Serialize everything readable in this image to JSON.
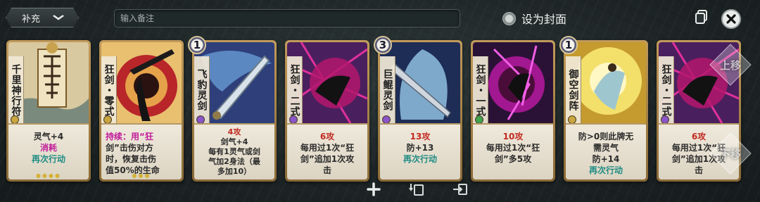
{
  "toolbar": {
    "dropdown_label": "补充",
    "note_placeholder": "输入备注",
    "set_cover_label": "设为封面"
  },
  "cards": [
    {
      "name": "千里神行符",
      "level": "",
      "lines": [
        "灵气+4",
        "消耗",
        "再次行动"
      ]
    },
    {
      "name": "狂剑・零式",
      "level": "",
      "lines": [
        "持续：用“狂",
        "剑”击伤对方",
        "时，恢复击伤",
        "值50%的生命"
      ]
    },
    {
      "name": "飞豹灵剑",
      "level": "1",
      "lines": [
        "4攻",
        "剑气+4",
        "每有1灵气或剑",
        "气加2身法（最",
        "多加10）"
      ]
    },
    {
      "name": "狂剑・二式",
      "level": "",
      "lines": [
        "6攻",
        "每用过1次“狂",
        "剑”追加1次攻",
        "击"
      ]
    },
    {
      "name": "巨鲲灵剑",
      "level": "3",
      "lines": [
        "13攻",
        "防+13",
        "再次行动"
      ]
    },
    {
      "name": "狂剑・一式",
      "level": "",
      "lines": [
        "10攻",
        "每用过1次“狂",
        "剑”多5攻"
      ]
    },
    {
      "name": "御空剑阵",
      "level": "1",
      "lines": [
        "防>0则此牌无",
        "需灵气",
        "防+14",
        "再次行动"
      ]
    },
    {
      "name": "狂剑・二式",
      "level": "",
      "lines": [
        "6攻",
        "每用过1次“狂",
        "剑”追加1次攻",
        "击"
      ]
    }
  ],
  "overlay": {
    "move_up_label": "上移",
    "move_down_label": "下移"
  },
  "icons": {
    "chevron": "chevron-down-icon",
    "copy": "copy-icon",
    "close": "close-icon",
    "add": "add-icon",
    "import": "import-icon",
    "export": "export-icon"
  },
  "colors": {
    "red": "#c22a22",
    "magenta": "#c21d9a",
    "teal": "#1f8c84",
    "orange": "#d07a14",
    "card_border": "#c29a5a"
  }
}
